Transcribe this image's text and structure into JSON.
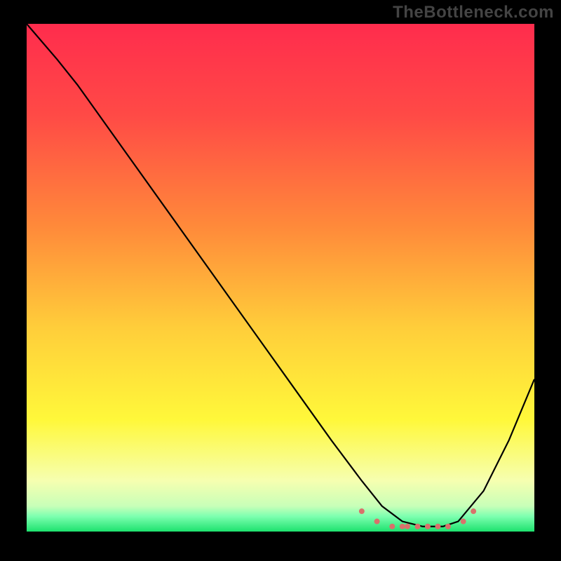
{
  "watermark": "TheBottleneck.com",
  "chart_data": {
    "type": "line",
    "title": "",
    "xlabel": "",
    "ylabel": "",
    "xlim": [
      0,
      100
    ],
    "ylim": [
      0,
      100
    ],
    "grid": false,
    "series": [
      {
        "name": "curve",
        "color": "#000000",
        "x": [
          0,
          6,
          10,
          20,
          30,
          40,
          50,
          60,
          66,
          70,
          74,
          78,
          82,
          85,
          90,
          95,
          100
        ],
        "y": [
          100,
          93,
          88,
          74,
          60,
          46,
          32,
          18,
          10,
          5,
          2,
          1,
          1,
          2,
          8,
          18,
          30
        ]
      }
    ],
    "markers": {
      "name": "highlight",
      "color": "#d9716b",
      "radius": 4,
      "x": [
        66,
        69,
        72,
        74,
        75,
        77,
        79,
        81,
        83,
        86,
        88
      ],
      "y": [
        4,
        2,
        1,
        1,
        1,
        1,
        1,
        1,
        1,
        2,
        4
      ]
    },
    "background_gradient": {
      "stops": [
        {
          "offset": 0.0,
          "color": "#ff2c4d"
        },
        {
          "offset": 0.18,
          "color": "#ff4a46"
        },
        {
          "offset": 0.4,
          "color": "#ff8a3a"
        },
        {
          "offset": 0.6,
          "color": "#ffce3a"
        },
        {
          "offset": 0.78,
          "color": "#fff83a"
        },
        {
          "offset": 0.9,
          "color": "#f6ffb0"
        },
        {
          "offset": 0.95,
          "color": "#c8ffb8"
        },
        {
          "offset": 0.97,
          "color": "#7dffb0"
        },
        {
          "offset": 1.0,
          "color": "#1de26e"
        }
      ]
    }
  }
}
